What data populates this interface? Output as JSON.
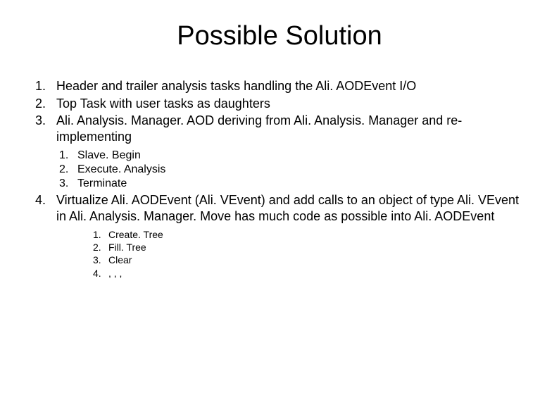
{
  "title": "Possible Solution",
  "items": [
    {
      "text": "Header and trailer analysis tasks handling the Ali. AODEvent I/O"
    },
    {
      "text": "Top Task with user tasks as daughters"
    },
    {
      "text": "Ali. Analysis. Manager. AOD deriving from Ali. Analysis. Manager and re-implementing",
      "sub": [
        "Slave. Begin",
        "Execute. Analysis",
        "Terminate"
      ],
      "subStyle": 1
    },
    {
      "text": "Virtualize Ali. AODEvent (Ali. VEvent) and add calls to an object of type Ali. VEvent in Ali. Analysis. Manager. Move has much code as possible into Ali. AODEvent",
      "sub": [
        "Create. Tree",
        "Fill. Tree",
        "Clear",
        ", , ,"
      ],
      "subStyle": 2
    }
  ]
}
